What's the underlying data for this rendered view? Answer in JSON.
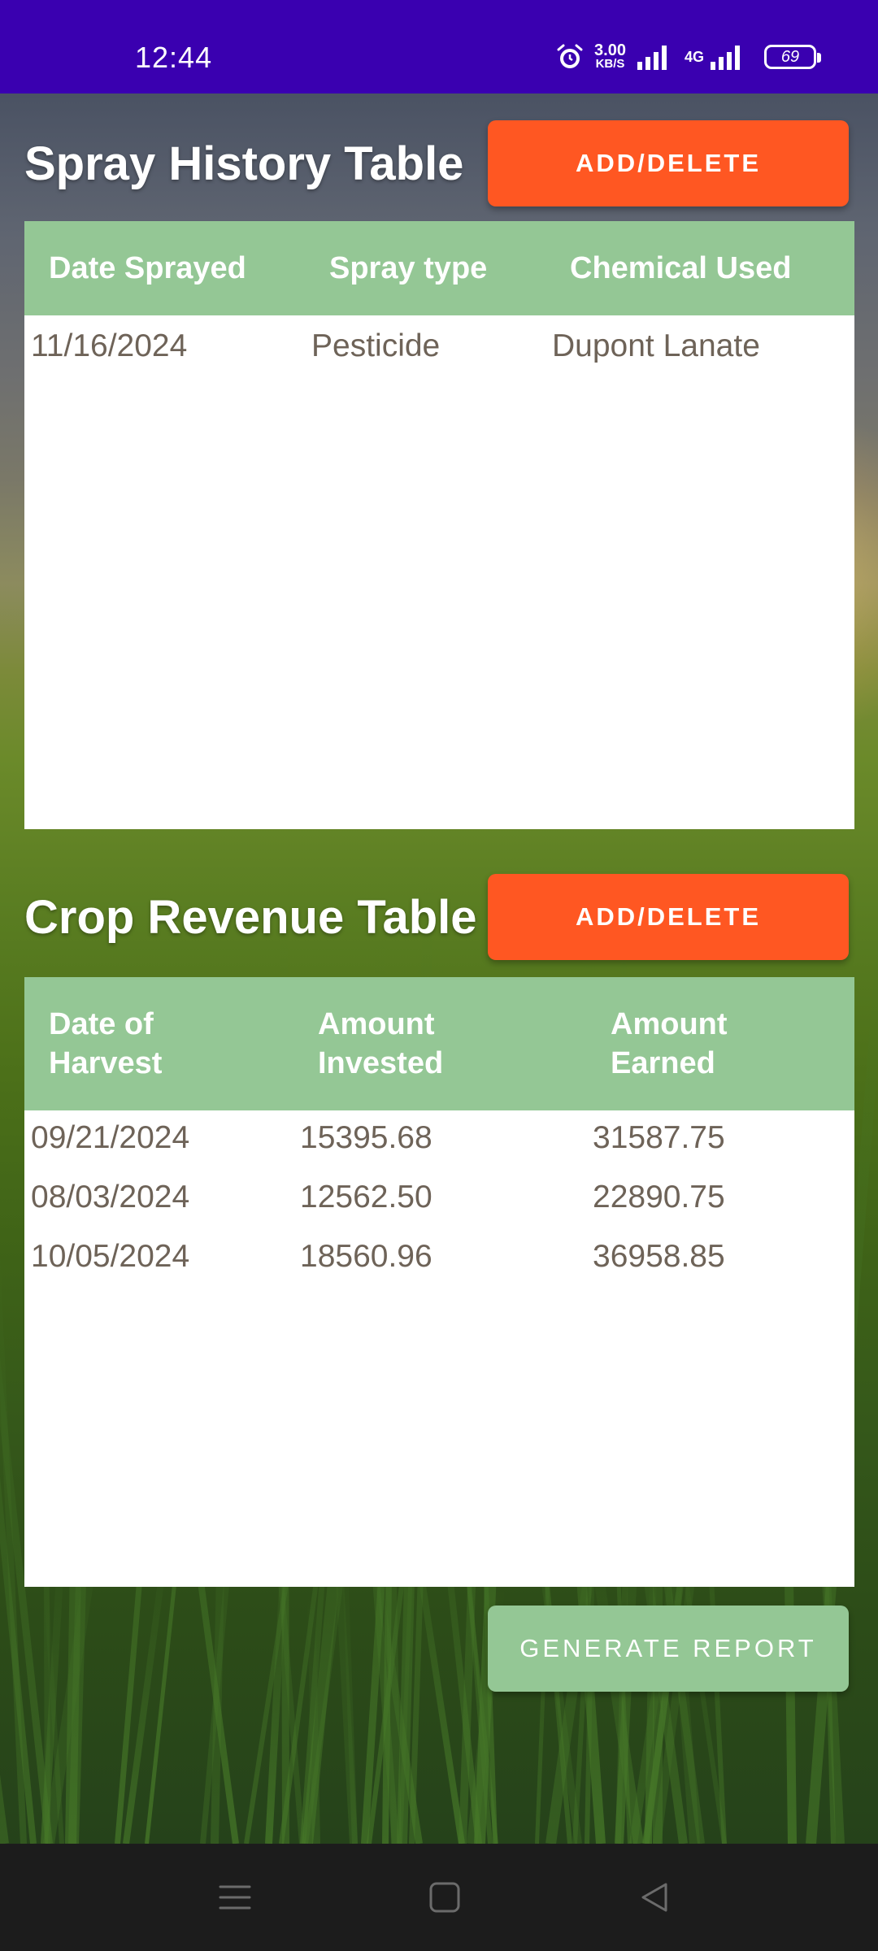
{
  "status_bar": {
    "time": "12:44",
    "net_speed": "3.00",
    "net_speed_unit": "KB/S",
    "network_type": "4G",
    "battery": "69",
    "icons": [
      "alarm-icon",
      "signal-icon",
      "battery-icon"
    ]
  },
  "spray_section": {
    "title": "Spray History Table",
    "button_label": "ADD/DELETE",
    "columns": [
      "Date Sprayed",
      "Spray type",
      "Chemical Used"
    ],
    "rows": [
      [
        "11/16/2024",
        "Pesticide",
        "Dupont Lanate"
      ]
    ]
  },
  "revenue_section": {
    "title": "Crop Revenue Table",
    "button_label": "ADD/DELETE",
    "columns": [
      [
        "Date of",
        "Harvest"
      ],
      [
        "Amount",
        "Invested"
      ],
      [
        "Amount",
        "Earned"
      ]
    ],
    "rows": [
      [
        "09/21/2024",
        "15395.68",
        "31587.75"
      ],
      [
        "08/03/2024",
        "12562.50",
        "22890.75"
      ],
      [
        "10/05/2024",
        "18560.96",
        "36958.85"
      ]
    ]
  },
  "report_button": {
    "label": "GENERATE REPORT"
  },
  "nav_bar": {
    "icons": [
      "menu-icon",
      "home-icon",
      "back-icon"
    ]
  },
  "colors": {
    "status_bar": "#3a00b0",
    "accent_orange": "#ff5722",
    "table_header_green": "#94c795",
    "cell_text": "#6e6358"
  }
}
